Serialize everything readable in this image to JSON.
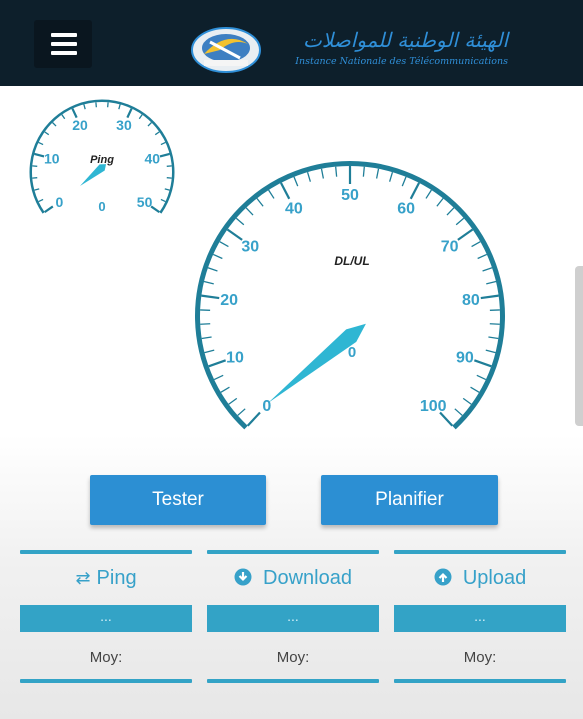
{
  "header": {
    "menu_icon": "hamburger-icon",
    "logo_emblem_icon": "telecom-authority-emblem",
    "logo_arabic": "الهيئة الوطنية للمواصلات",
    "logo_french": "Instance Nationale des Télécommunications",
    "colors": {
      "bar": "#0d1f2b",
      "logo_text": "#2f8fd8"
    }
  },
  "ping_gauge": {
    "label": "Ping",
    "value": "0",
    "ticks": [
      "0",
      "10",
      "20",
      "30",
      "40",
      "50"
    ]
  },
  "speed_gauge": {
    "label": "DL/UL",
    "value": "0",
    "ticks": [
      "0",
      "10",
      "20",
      "30",
      "40",
      "50",
      "60",
      "70",
      "80",
      "90",
      "100"
    ]
  },
  "actions": {
    "test_label": "Tester",
    "schedule_label": "Planifier",
    "color": "#2c8fd3"
  },
  "stats": [
    {
      "icon": "swap-arrows-icon",
      "label": "Ping",
      "value": "...",
      "avg_label": "Moy:"
    },
    {
      "icon": "download-circle-icon",
      "label": "Download",
      "value": "...",
      "avg_label": "Moy:"
    },
    {
      "icon": "upload-circle-icon",
      "label": "Upload",
      "value": "...",
      "avg_label": "Moy:"
    }
  ],
  "accent_color": "#33a3c6"
}
